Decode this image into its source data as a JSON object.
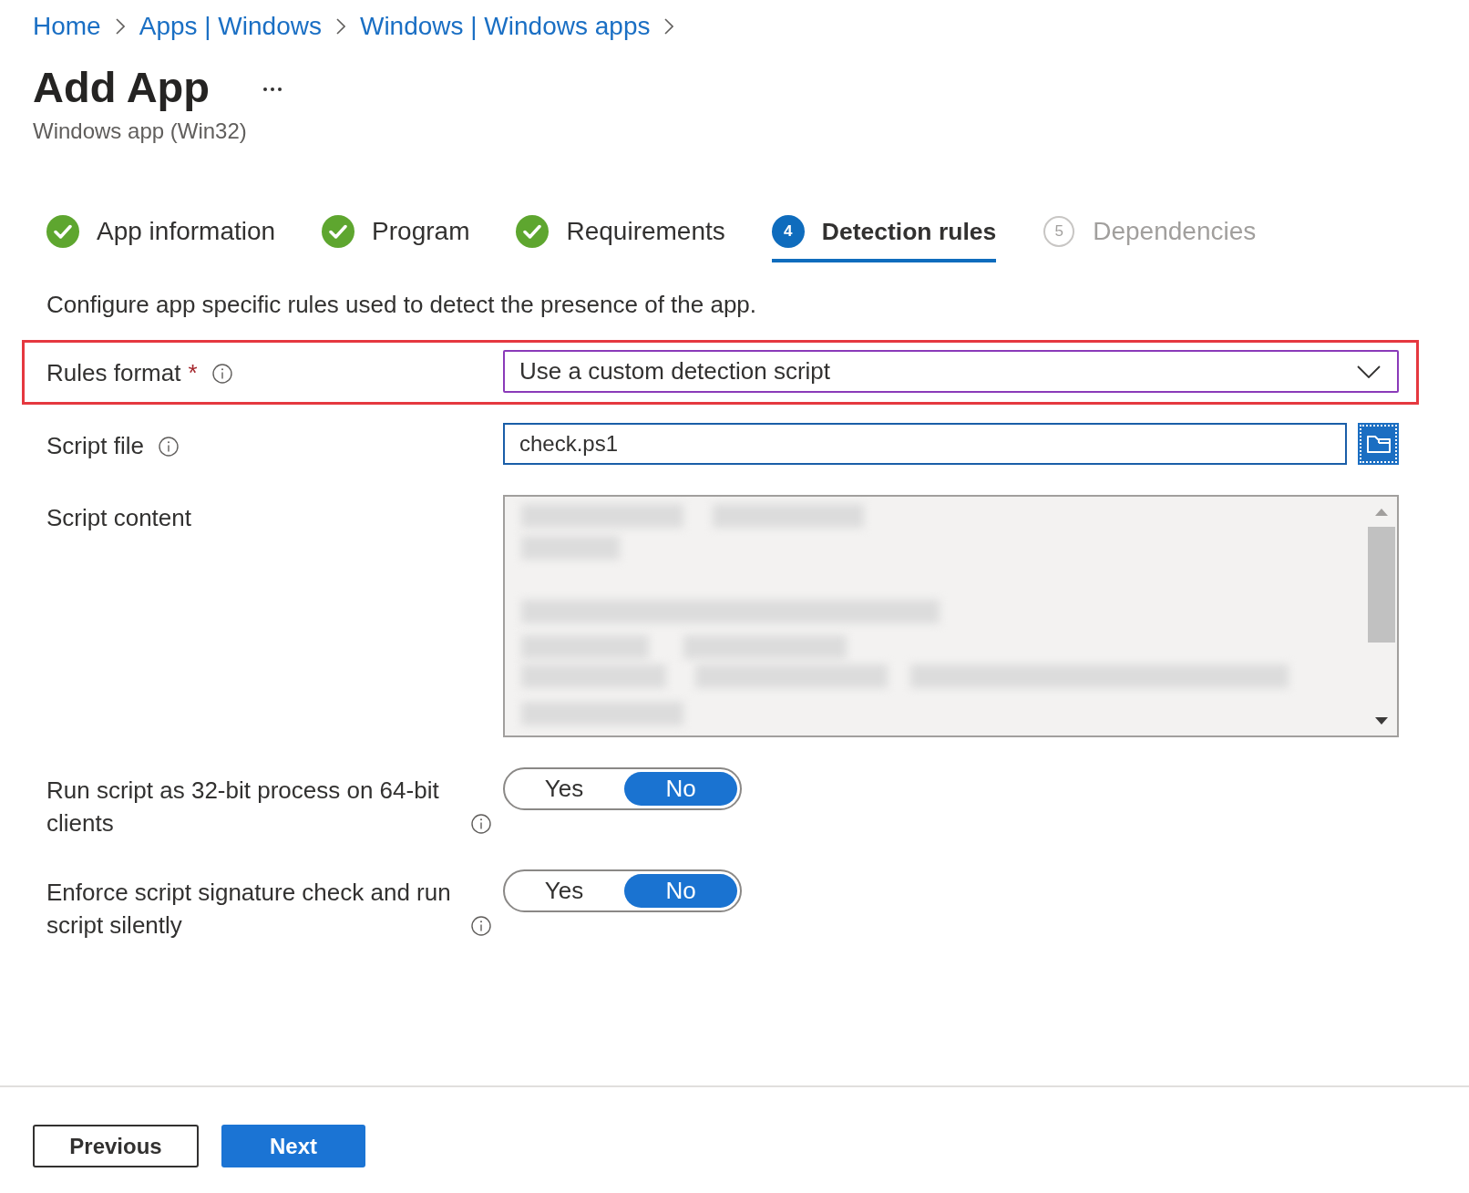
{
  "breadcrumb": [
    {
      "label": "Home"
    },
    {
      "label": "Apps | Windows"
    },
    {
      "label": "Windows | Windows apps"
    }
  ],
  "header": {
    "title": "Add App",
    "subtitle": "Windows app (Win32)"
  },
  "steps": [
    {
      "label": "App information",
      "kind": "done",
      "selected": false
    },
    {
      "label": "Program",
      "kind": "done",
      "selected": false
    },
    {
      "label": "Requirements",
      "kind": "done",
      "selected": false
    },
    {
      "label": "Detection rules",
      "number": "4",
      "kind": "current",
      "selected": true
    },
    {
      "label": "Dependencies",
      "number": "5",
      "kind": "pending",
      "selected": false
    }
  ],
  "description": "Configure app specific rules used to detect the presence of the app.",
  "fields": [
    {
      "kind": "dropdown",
      "label": "Rules format",
      "required_mark": "*",
      "info": true,
      "highlighted": true,
      "value": "Use a custom detection script"
    },
    {
      "kind": "file",
      "label": "Script file",
      "info": true,
      "highlighted": false,
      "value": "check.ps1"
    },
    {
      "kind": "script",
      "label": "Script content",
      "info": false,
      "highlighted": false
    },
    {
      "kind": "toggle",
      "label": "Run script as 32-bit process on 64-bit clients",
      "info": true,
      "highlighted": false,
      "options": [
        {
          "label": "Yes",
          "selected": false
        },
        {
          "label": "No",
          "selected": true
        }
      ]
    },
    {
      "kind": "toggle",
      "label": "Enforce script signature check and run script silently",
      "info": true,
      "highlighted": false,
      "options": [
        {
          "label": "Yes",
          "selected": false
        },
        {
          "label": "No",
          "selected": true
        }
      ]
    }
  ],
  "buttons": [
    {
      "label": "Previous",
      "kind": "secondary"
    },
    {
      "label": "Next",
      "kind": "primary"
    }
  ]
}
